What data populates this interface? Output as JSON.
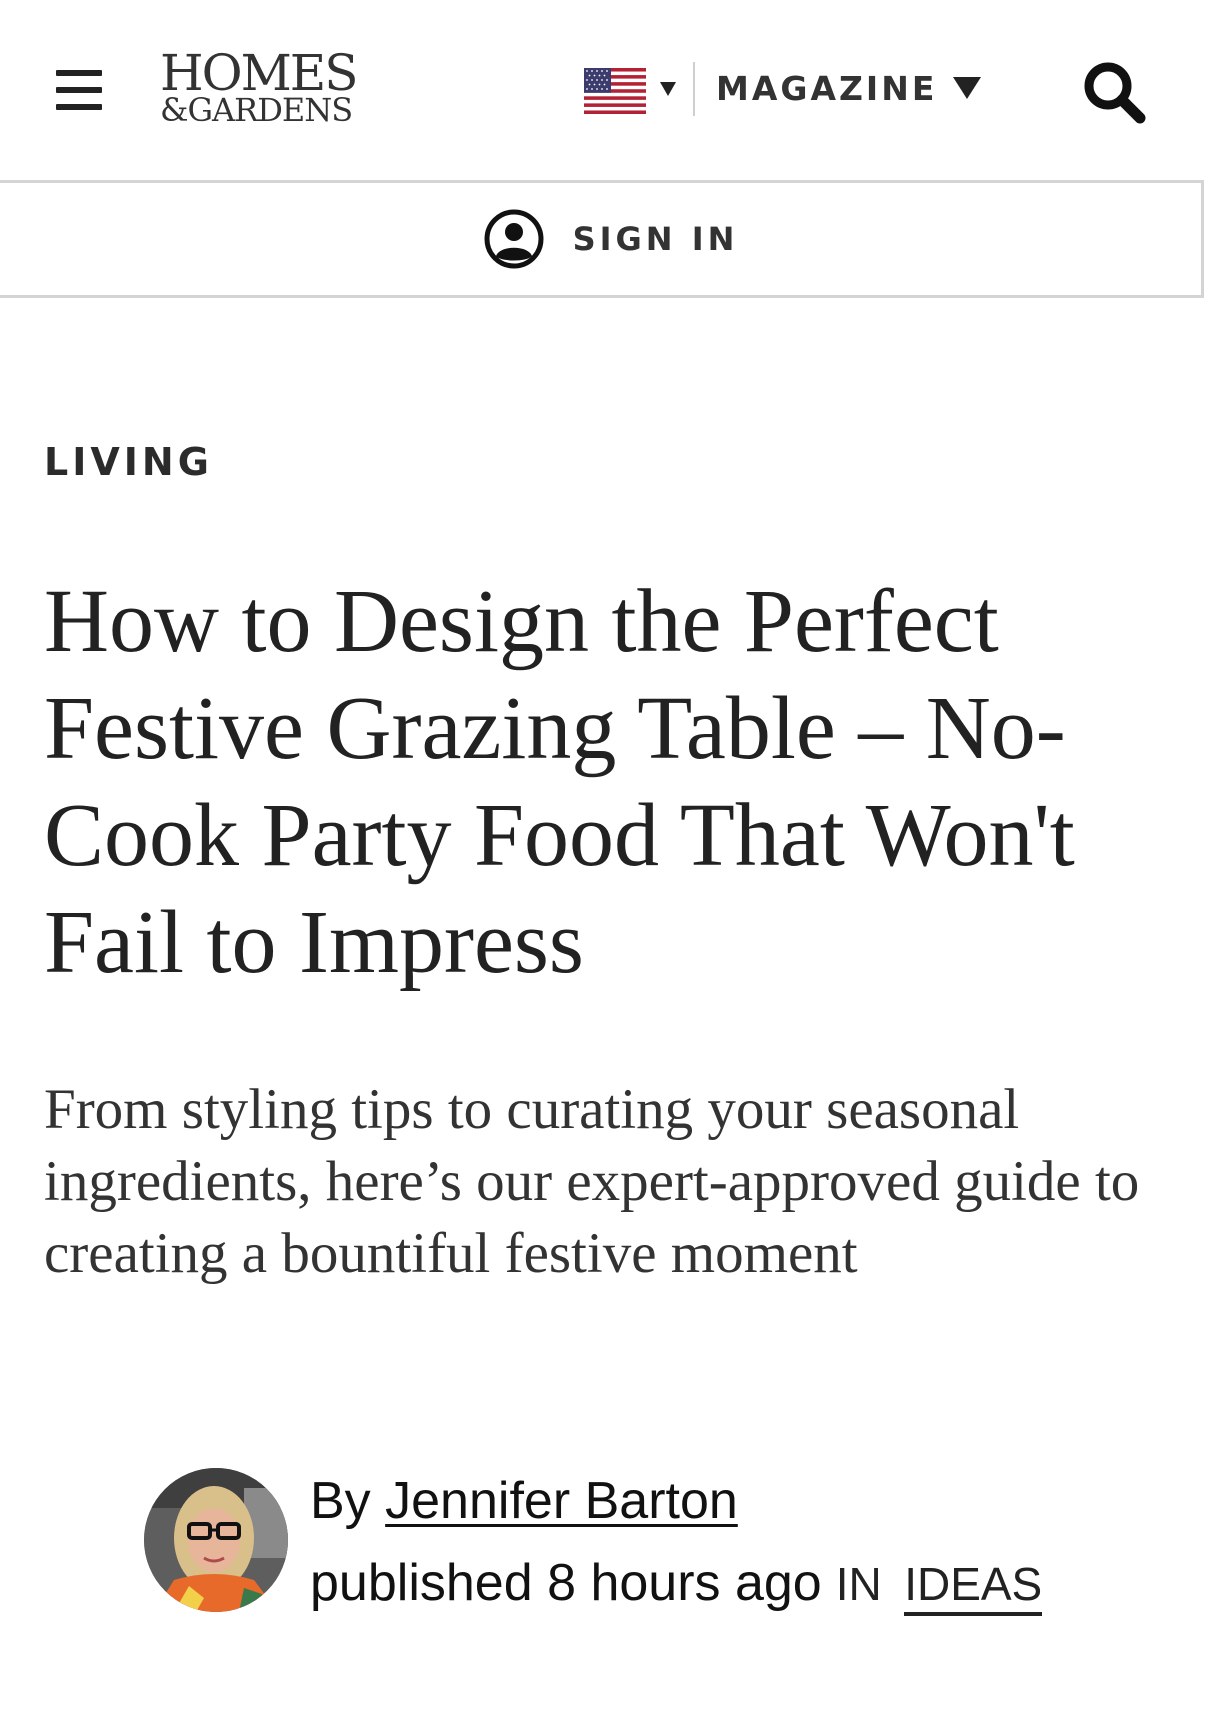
{
  "header": {
    "logo_line1": "HOMES",
    "logo_line2": "&GARDENS",
    "region_flag": "us-flag-icon",
    "magazine_label": "MAGAZINE",
    "search_icon": "search-icon",
    "menu_icon": "hamburger-menu-icon"
  },
  "signin": {
    "label": "SIGN IN",
    "icon": "user-circle-icon"
  },
  "article": {
    "category": "LIVING",
    "title": "How to Design the Perfect Festive Grazing Table – No-Cook Party Food That Won't Fail to Impress",
    "subtitle": "From styling tips to curating your seasonal ingredients, here’s our expert-approved guide to creating a bountiful festive moment"
  },
  "byline": {
    "by_prefix": "By",
    "author": "Jennifer Barton",
    "published": "published 8 hours ago",
    "in_label": "IN",
    "section": "IDEAS"
  },
  "colors": {
    "text": "#222222",
    "divider": "#d4d4d4",
    "flag_red": "#b22234",
    "flag_blue": "#3c3b6e"
  }
}
